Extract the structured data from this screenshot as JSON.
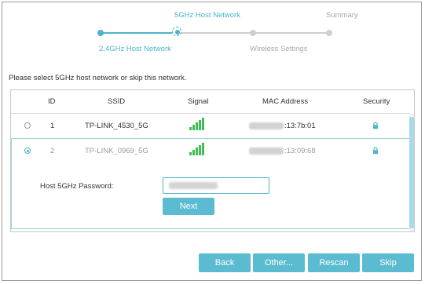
{
  "stepper": {
    "steps": [
      {
        "label": "2.4GHz Host Network",
        "state": "done"
      },
      {
        "label": "5GHz Host Network",
        "state": "current"
      },
      {
        "label": "Wireless Settings",
        "state": "pending"
      },
      {
        "label": "Summary",
        "state": "pending"
      }
    ]
  },
  "instruction": "Please select 5GHz host network or skip this network.",
  "table": {
    "columns": [
      "ID",
      "SSID",
      "Signal",
      "MAC Address",
      "Security"
    ],
    "rows": [
      {
        "id": "1",
        "ssid": "TP-LINK_4530_5G",
        "signal": 5,
        "mac_suffix": ":13:7b:01",
        "secured": true,
        "selected": false
      },
      {
        "id": "2",
        "ssid": "TP-LINK_0969_5G",
        "signal": 5,
        "mac_suffix": ":13:09:68",
        "secured": true,
        "selected": true
      }
    ]
  },
  "password": {
    "label": "Host 5GHz Password:",
    "value": ""
  },
  "buttons": {
    "next": "Next",
    "back": "Back",
    "other": "Other...",
    "rescan": "Rescan",
    "skip": "Skip"
  },
  "colors": {
    "accent": "#5bbbd0",
    "signal": "#3fbf52",
    "inactive": "#c8c8c8"
  }
}
